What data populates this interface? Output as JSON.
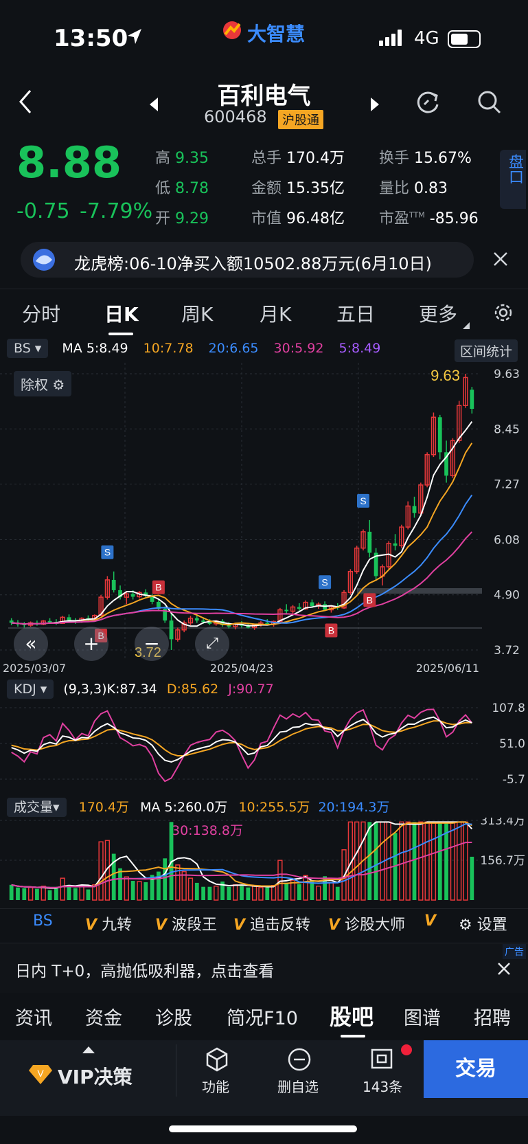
{
  "status": {
    "time": "13:50",
    "network": "4G",
    "brand": "大智慧"
  },
  "stock": {
    "name": "百利电气",
    "code": "600468",
    "tag": "沪股通",
    "price": "8.88",
    "change": "-0.75",
    "change_pct": "-7.79%"
  },
  "quote": {
    "high_label": "高",
    "high": "9.35",
    "low_label": "低",
    "low": "8.78",
    "open_label": "开",
    "open": "9.29",
    "volume_label": "总手",
    "volume": "170.4万",
    "amount_label": "金额",
    "amount": "15.35亿",
    "mcap_label": "市值",
    "mcap": "96.48亿",
    "turnover_label": "换手",
    "turnover": "15.67%",
    "vol_ratio_label": "量比",
    "vol_ratio": "0.83",
    "pe_label": "市盈",
    "pe_sup": "TTM",
    "pe": "-85.96"
  },
  "pankou": {
    "label": "盘口"
  },
  "news": {
    "text": "龙虎榜:06-10净买入额10502.88万元(6月10日)"
  },
  "tabs": [
    "分时",
    "日K",
    "周K",
    "月K",
    "五日",
    "更多"
  ],
  "active_tab": "日K",
  "ma_bar": {
    "selector": "BS",
    "ma_label": "MA 5:8.49",
    "ma10": "10:7.78",
    "ma20": "20:6.65",
    "ma30": "30:5.92",
    "ma5b": "5:8.49",
    "range_stats": "区间统计"
  },
  "chart": {
    "adjust": "除权",
    "y_ticks": [
      "9.63",
      "8.45",
      "7.27",
      "6.08",
      "4.90",
      "3.72"
    ],
    "x_ticks": [
      "2025/03/07",
      "2025/04/23",
      "2025/06/11"
    ],
    "high_marker": "9.63",
    "low_marker": "3.72"
  },
  "kdj": {
    "selector": "KDJ",
    "params": "(9,3,3)K:87.34",
    "d": "D:85.62",
    "j": "J:90.77",
    "y_ticks": [
      "107.8",
      "51.0",
      "-5.7"
    ]
  },
  "vol": {
    "selector": "成交量",
    "current": "170.4万",
    "ma5": "MA 5:260.0万",
    "ma10": "10:255.5万",
    "ma20": "20:194.3万",
    "ma30": "30:138.8万",
    "y_ticks": [
      "313.4万",
      "156.7万"
    ]
  },
  "strategy": {
    "bs": "BS",
    "items": [
      "九转",
      "波段王",
      "追击反转",
      "诊股大师"
    ],
    "vip_mark": "V",
    "settings": "设置"
  },
  "ad": {
    "text": "日内 T+0，高抛低吸利器，点击查看",
    "tag": "广告"
  },
  "bottom_tabs": [
    "资讯",
    "资金",
    "诊股",
    "简况F10",
    "股吧",
    "图谱",
    "招聘"
  ],
  "bottom_active": "股吧",
  "toolbar": {
    "vip": "VIP决策",
    "func": "功能",
    "remove": "删自选",
    "count": "143条",
    "trade": "交易"
  },
  "colors": {
    "up": "#e8383a",
    "down": "#19c25a",
    "ma5": "#ffffff",
    "ma10": "#f5a623",
    "ma20": "#3b8cff",
    "ma30": "#e040a0",
    "ma5b": "#a65cff",
    "accent": "#2c6ae0"
  },
  "chart_data": {
    "type": "candlestick",
    "y_range": [
      3.72,
      9.63
    ],
    "candles": [
      [
        4.35,
        4.4,
        4.25,
        4.3
      ],
      [
        4.3,
        4.36,
        4.22,
        4.28
      ],
      [
        4.28,
        4.32,
        4.2,
        4.25
      ],
      [
        4.25,
        4.33,
        4.22,
        4.3
      ],
      [
        4.3,
        4.35,
        4.24,
        4.27
      ],
      [
        4.27,
        4.36,
        4.25,
        4.34
      ],
      [
        4.34,
        4.4,
        4.3,
        4.32
      ],
      [
        4.32,
        4.38,
        4.26,
        4.29
      ],
      [
        4.29,
        4.45,
        4.28,
        4.42
      ],
      [
        4.42,
        4.48,
        4.34,
        4.36
      ],
      [
        4.36,
        4.4,
        4.28,
        4.33
      ],
      [
        4.33,
        4.42,
        4.3,
        4.4
      ],
      [
        4.4,
        4.46,
        4.35,
        4.38
      ],
      [
        4.38,
        4.48,
        4.36,
        4.46
      ],
      [
        4.46,
        4.9,
        4.44,
        4.85
      ],
      [
        4.85,
        5.3,
        4.8,
        5.22
      ],
      [
        5.22,
        5.4,
        4.95,
        5.0
      ],
      [
        5.0,
        5.1,
        4.8,
        4.85
      ],
      [
        4.85,
        4.95,
        4.7,
        4.92
      ],
      [
        4.92,
        5.0,
        4.8,
        4.86
      ],
      [
        4.86,
        4.98,
        4.82,
        4.95
      ],
      [
        4.95,
        5.02,
        4.85,
        4.88
      ],
      [
        4.88,
        4.92,
        4.7,
        4.75
      ],
      [
        4.75,
        4.8,
        4.55,
        4.6
      ],
      [
        4.6,
        4.65,
        4.3,
        4.35
      ],
      [
        4.35,
        4.55,
        3.72,
        3.95
      ],
      [
        3.95,
        4.2,
        3.9,
        4.15
      ],
      [
        4.15,
        4.35,
        4.1,
        4.3
      ],
      [
        4.3,
        4.45,
        4.25,
        4.4
      ],
      [
        4.4,
        4.48,
        4.3,
        4.35
      ],
      [
        4.35,
        4.42,
        4.28,
        4.32
      ],
      [
        4.32,
        4.38,
        4.25,
        4.28
      ],
      [
        4.28,
        4.36,
        4.24,
        4.34
      ],
      [
        4.34,
        4.38,
        4.22,
        4.25
      ],
      [
        4.25,
        4.32,
        4.18,
        4.22
      ],
      [
        4.22,
        4.3,
        4.16,
        4.28
      ],
      [
        4.28,
        4.34,
        4.2,
        4.24
      ],
      [
        4.24,
        4.3,
        4.18,
        4.2
      ],
      [
        4.2,
        4.28,
        4.15,
        4.26
      ],
      [
        4.26,
        4.34,
        4.22,
        4.3
      ],
      [
        4.3,
        4.38,
        4.25,
        4.27
      ],
      [
        4.27,
        4.35,
        4.22,
        4.33
      ],
      [
        4.33,
        4.62,
        4.3,
        4.58
      ],
      [
        4.58,
        4.7,
        4.5,
        4.55
      ],
      [
        4.55,
        4.68,
        4.5,
        4.64
      ],
      [
        4.64,
        4.72,
        4.55,
        4.6
      ],
      [
        4.6,
        4.78,
        4.58,
        4.74
      ],
      [
        4.74,
        4.8,
        4.62,
        4.66
      ],
      [
        4.66,
        4.74,
        4.6,
        4.7
      ],
      [
        4.7,
        4.76,
        4.55,
        4.58
      ],
      [
        4.58,
        4.68,
        4.52,
        4.65
      ],
      [
        4.65,
        4.72,
        4.58,
        4.62
      ],
      [
        4.62,
        5.0,
        4.6,
        4.95
      ],
      [
        4.95,
        5.45,
        4.9,
        5.4
      ],
      [
        5.4,
        5.95,
        5.35,
        5.9
      ],
      [
        5.9,
        6.3,
        5.85,
        6.25
      ],
      [
        6.25,
        6.5,
        5.7,
        5.8
      ],
      [
        5.8,
        5.9,
        5.2,
        5.3
      ],
      [
        5.3,
        5.55,
        5.1,
        5.5
      ],
      [
        5.5,
        6.05,
        5.45,
        6.0
      ],
      [
        6.0,
        6.2,
        5.85,
        5.95
      ],
      [
        5.95,
        6.4,
        5.9,
        6.35
      ],
      [
        6.35,
        6.9,
        6.3,
        6.8
      ],
      [
        6.8,
        7.0,
        6.55,
        6.65
      ],
      [
        6.65,
        7.3,
        6.6,
        7.25
      ],
      [
        7.25,
        7.95,
        7.2,
        7.9
      ],
      [
        7.9,
        8.8,
        7.85,
        8.7
      ],
      [
        8.7,
        8.75,
        7.8,
        7.95
      ],
      [
        7.95,
        8.2,
        7.3,
        7.45
      ],
      [
        7.45,
        8.25,
        7.4,
        8.2
      ],
      [
        8.2,
        9.05,
        8.15,
        8.95
      ],
      [
        8.95,
        9.63,
        8.9,
        9.55
      ],
      [
        9.29,
        9.35,
        8.78,
        8.88
      ]
    ],
    "kdj_range": [
      -5.7,
      107.8
    ],
    "volume_max": 313.4
  }
}
